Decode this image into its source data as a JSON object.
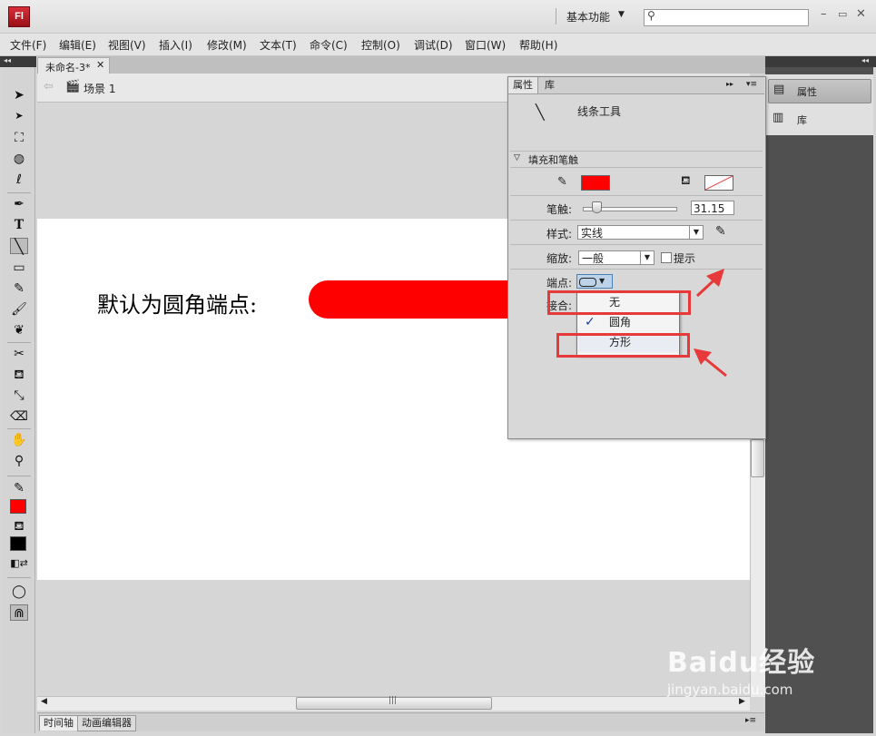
{
  "app": {
    "logo": "Fl",
    "workspace": "基本功能"
  },
  "menu": [
    "文件(F)",
    "编辑(E)",
    "视图(V)",
    "插入(I)",
    "修改(M)",
    "文本(T)",
    "命令(C)",
    "控制(O)",
    "调试(D)",
    "窗口(W)",
    "帮助(H)"
  ],
  "document": {
    "tab_title": "未命名-3*",
    "scene": "场景 1"
  },
  "stage": {
    "text": "默认为圆角端点:",
    "line_color": "#ff0000"
  },
  "properties": {
    "tabs": [
      "属性",
      "库"
    ],
    "tool_name": "线条工具",
    "section_title": "填充和笔触",
    "stroke_color": "#ff0000",
    "stroke_label": "笔触:",
    "stroke_value": "31.15",
    "style_label": "样式:",
    "style_value": "实线",
    "scale_label": "缩放:",
    "scale_value": "一般",
    "hint_label": "提示",
    "cap_label": "端点:",
    "join_label": "接合:"
  },
  "cap_dropdown": {
    "items": [
      "无",
      "圆角",
      "方形"
    ],
    "selected": "圆角"
  },
  "dock": {
    "items": [
      "属性",
      "库"
    ]
  },
  "bottom_tabs": [
    "时间轴",
    "动画编辑器"
  ],
  "watermark": {
    "brand": "Baidu经验",
    "url": "jingyan.baidu.com"
  },
  "colors": {
    "fill": "#ff0000",
    "stroke_swatch": "#000000",
    "highlight": "#e8393a"
  }
}
